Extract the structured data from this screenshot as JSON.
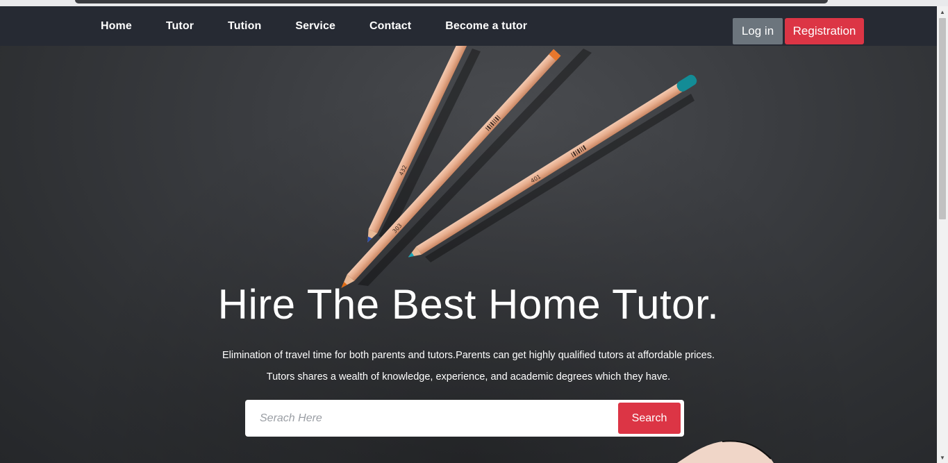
{
  "nav": {
    "links": [
      "Home",
      "Tutor",
      "Tution",
      "Service",
      "Contact",
      "Become a tutor"
    ],
    "login_label": "Log in",
    "register_label": "Registration"
  },
  "hero": {
    "headline": "Hire The Best Home Tutor.",
    "line1": "Elimination of travel time for both parents and tutors.Parents can get highly qualified tutors at affordable prices.",
    "line2": "Tutors shares a wealth of knowledge, experience, and academic degrees which they have.",
    "search_placeholder": "Serach Here",
    "search_button": "Search",
    "pencil_numbers": [
      "432",
      "303",
      "401"
    ]
  },
  "colors": {
    "navbar": "#262a33",
    "accent_red": "#dc3545",
    "login_gray": "#6c757d"
  }
}
